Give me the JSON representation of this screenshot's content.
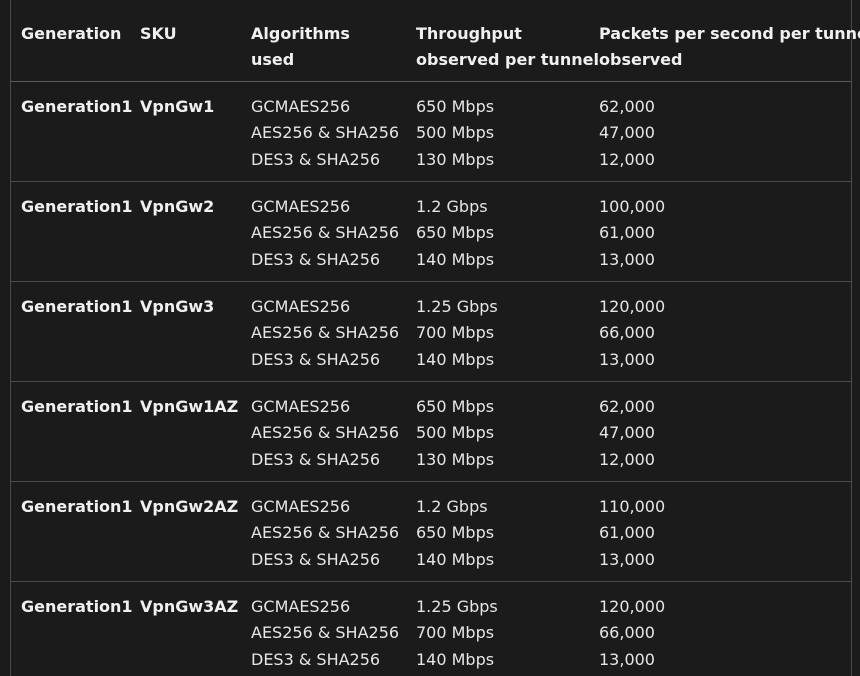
{
  "headers": {
    "generation": "Generation",
    "sku": "SKU",
    "algorithms_line1": "Algorithms",
    "algorithms_line2": "used",
    "throughput_line1": "Throughput",
    "throughput_line2": "observed per tunnel",
    "pps_line1": "Packets per second per tunnel",
    "pps_line2": "observed"
  },
  "rows": [
    {
      "generation": "Generation1",
      "sku": "VpnGw1",
      "algorithms": [
        "GCMAES256",
        "AES256 & SHA256",
        "DES3 & SHA256"
      ],
      "throughput": [
        "650 Mbps",
        "500 Mbps",
        "130 Mbps"
      ],
      "pps": [
        "62,000",
        "47,000",
        "12,000"
      ]
    },
    {
      "generation": "Generation1",
      "sku": "VpnGw2",
      "algorithms": [
        "GCMAES256",
        "AES256 & SHA256",
        "DES3 & SHA256"
      ],
      "throughput": [
        "1.2 Gbps",
        "650 Mbps",
        "140 Mbps"
      ],
      "pps": [
        "100,000",
        "61,000",
        "13,000"
      ]
    },
    {
      "generation": "Generation1",
      "sku": "VpnGw3",
      "algorithms": [
        "GCMAES256",
        "AES256 & SHA256",
        "DES3 & SHA256"
      ],
      "throughput": [
        "1.25 Gbps",
        "700 Mbps",
        "140 Mbps"
      ],
      "pps": [
        "120,000",
        "66,000",
        "13,000"
      ]
    },
    {
      "generation": "Generation1",
      "sku": "VpnGw1AZ",
      "algorithms": [
        "GCMAES256",
        "AES256 & SHA256",
        "DES3 & SHA256"
      ],
      "throughput": [
        "650 Mbps",
        "500 Mbps",
        "130 Mbps"
      ],
      "pps": [
        "62,000",
        "47,000",
        "12,000"
      ]
    },
    {
      "generation": "Generation1",
      "sku": "VpnGw2AZ",
      "algorithms": [
        "GCMAES256",
        "AES256 & SHA256",
        "DES3 & SHA256"
      ],
      "throughput": [
        "1.2 Gbps",
        "650 Mbps",
        "140 Mbps"
      ],
      "pps": [
        "110,000",
        "61,000",
        "13,000"
      ]
    },
    {
      "generation": "Generation1",
      "sku": "VpnGw3AZ",
      "algorithms": [
        "GCMAES256",
        "AES256 & SHA256",
        "DES3 & SHA256"
      ],
      "throughput": [
        "1.25 Gbps",
        "700 Mbps",
        "140 Mbps"
      ],
      "pps": [
        "120,000",
        "66,000",
        "13,000"
      ]
    }
  ]
}
